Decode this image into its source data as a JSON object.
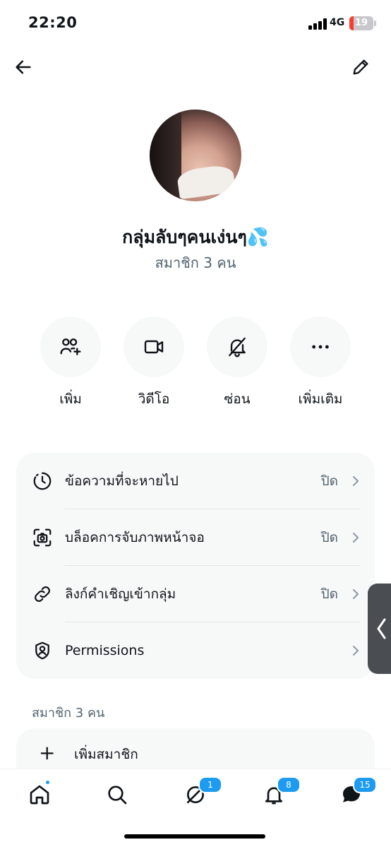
{
  "status_bar": {
    "time": "22:20",
    "network": "4G",
    "battery": "19",
    "battery_level": 0.19,
    "battery_color": "#ff3b30"
  },
  "header": {
    "back_icon": "arrow-left-icon",
    "edit_icon": "pencil-icon"
  },
  "group": {
    "name": "กลุ่มลับๆคนเง่นๆ💦",
    "members": "สมาชิก 3 คน"
  },
  "actions": [
    {
      "label": "เพิ่ม",
      "icon": "add-people-icon"
    },
    {
      "label": "วิดีโอ",
      "icon": "video-icon"
    },
    {
      "label": "ซ่อน",
      "icon": "bell-off-icon"
    },
    {
      "label": "เพิ่มเติม",
      "icon": "more-icon"
    }
  ],
  "settings": [
    {
      "label": "ข้อความที่จะหายไป",
      "value": "ปิด",
      "icon": "timer-icon"
    },
    {
      "label": "บล็อคการจับภาพหน้าจอ",
      "value": "ปิด",
      "icon": "screenshot-block-icon"
    },
    {
      "label": "ลิงก์คำเชิญเข้ากลุ่ม",
      "value": "ปิด",
      "icon": "link-icon"
    },
    {
      "label": "Permissions",
      "value": "",
      "icon": "shield-person-icon"
    }
  ],
  "members_section": {
    "title": "สมาชิก 3 คน",
    "add_label": "เพิ่มสมาชิก",
    "add_symbol": "+"
  },
  "tab_bar": {
    "home_icon": "home-icon",
    "search_icon": "search-icon",
    "grok_icon": "grok-icon",
    "grok_badge": "1",
    "notifications_icon": "bell-icon",
    "notifications_badge": "8",
    "messages_icon": "messages-icon",
    "messages_badge": "15",
    "accent": "#1d9bf0"
  }
}
